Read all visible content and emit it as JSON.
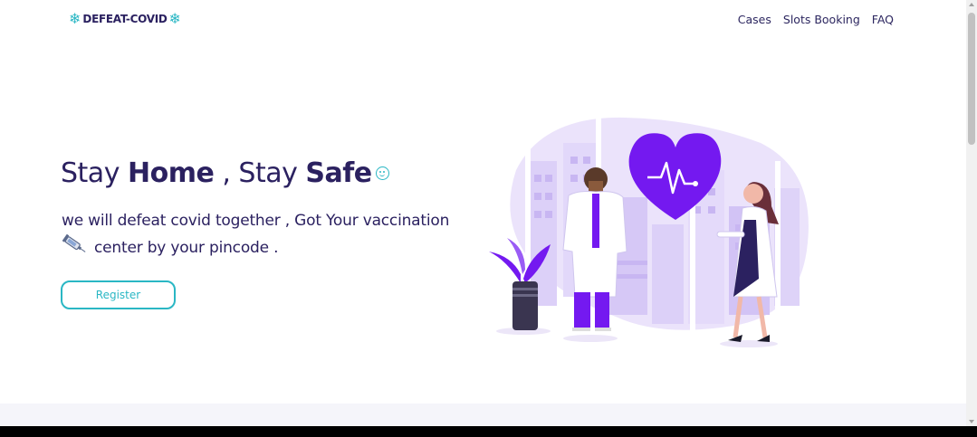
{
  "nav": {
    "brand": "DEFEAT-COVID",
    "brand_icon": "snowflake-icon",
    "links": [
      "Cases",
      "Slots Booking",
      "FAQ"
    ]
  },
  "hero": {
    "headline_part1": "Stay ",
    "headline_bold1": "Home",
    "headline_part2": " , Stay ",
    "headline_bold2": "Safe",
    "subtitle_line1": "we will defeat covid together , Got Your vaccination",
    "subtitle_line2": "center by your pincode .",
    "register_label": "Register",
    "smile_icon": "smiley-icon",
    "syringe_icon": "syringe-icon",
    "illustration": "doctors-heart-illustration"
  },
  "colors": {
    "primary_text": "#2b2160",
    "accent_teal": "#2ab7c4",
    "accent_purple": "#7419f0"
  }
}
